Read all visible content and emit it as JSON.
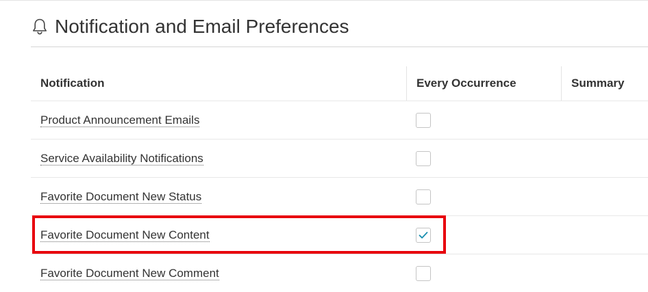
{
  "header": {
    "icon": "bell-icon",
    "title": "Notification and Email Preferences"
  },
  "table": {
    "columns": {
      "notification": "Notification",
      "every_occurrence": "Every Occurrence",
      "summary": "Summary"
    },
    "rows": [
      {
        "label": "Product Announcement Emails",
        "every_occurrence": false
      },
      {
        "label": "Service Availability Notifications",
        "every_occurrence": false
      },
      {
        "label": "Favorite Document New Status",
        "every_occurrence": false
      },
      {
        "label": "Favorite Document New Content",
        "every_occurrence": true,
        "highlighted": true
      },
      {
        "label": "Favorite Document New Comment",
        "every_occurrence": false
      }
    ]
  },
  "colors": {
    "highlight": "#e8000b",
    "check": "#1a8fb0"
  }
}
